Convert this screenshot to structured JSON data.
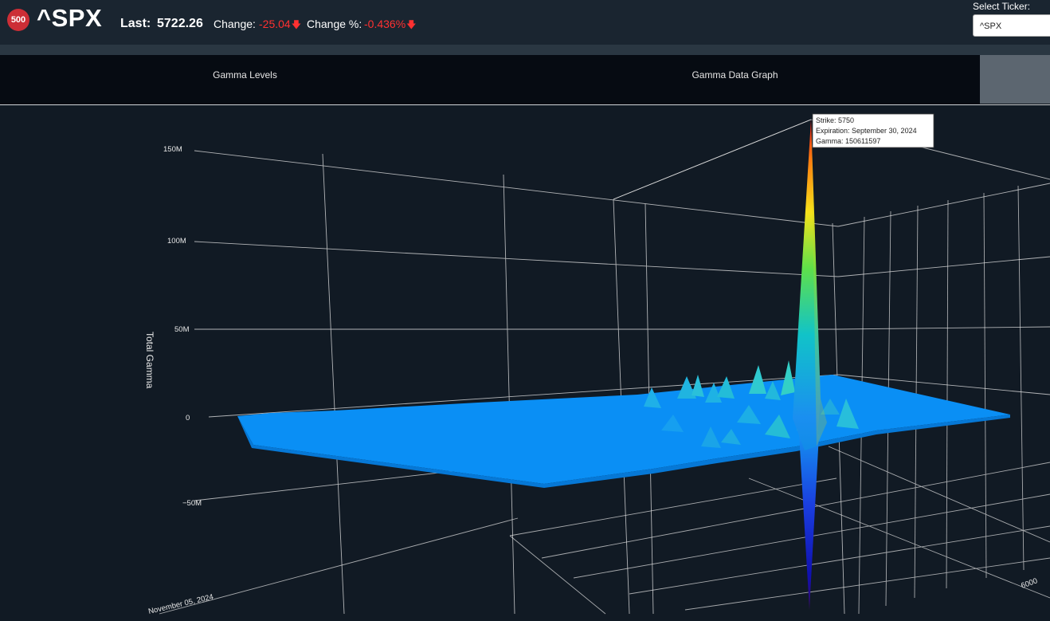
{
  "header": {
    "badge": "500",
    "symbol": "^SPX",
    "last_label": "Last:",
    "last_value": "5722.26",
    "change_label": "Change:",
    "change_value": "-25.04",
    "change_pct_label": "Change %:",
    "change_pct_value": "-0.436%",
    "down_color": "#ff3131"
  },
  "ticker_select": {
    "label": "Select Ticker:",
    "value": "^SPX"
  },
  "tabs": [
    {
      "label": "Gamma Levels"
    },
    {
      "label": "Gamma Data Graph"
    },
    {
      "label": ""
    }
  ],
  "chart_data": {
    "type": "surface",
    "zlabel": "Total Gamma",
    "z_ticks": [
      "150M",
      "100M",
      "50M",
      "0",
      "−50M"
    ],
    "x_tick_visible": "November 05, 2024",
    "y_tick_visible": "6000",
    "colorscale": "jet",
    "baseline_color": "#0a8ff5",
    "peak": {
      "strike": 5750,
      "expiration": "September 30, 2024",
      "gamma": 150611597
    },
    "tooltip": [
      "Strike: 5750",
      "Expiration: September 30, 2024",
      "Gamma: 150611597"
    ]
  }
}
